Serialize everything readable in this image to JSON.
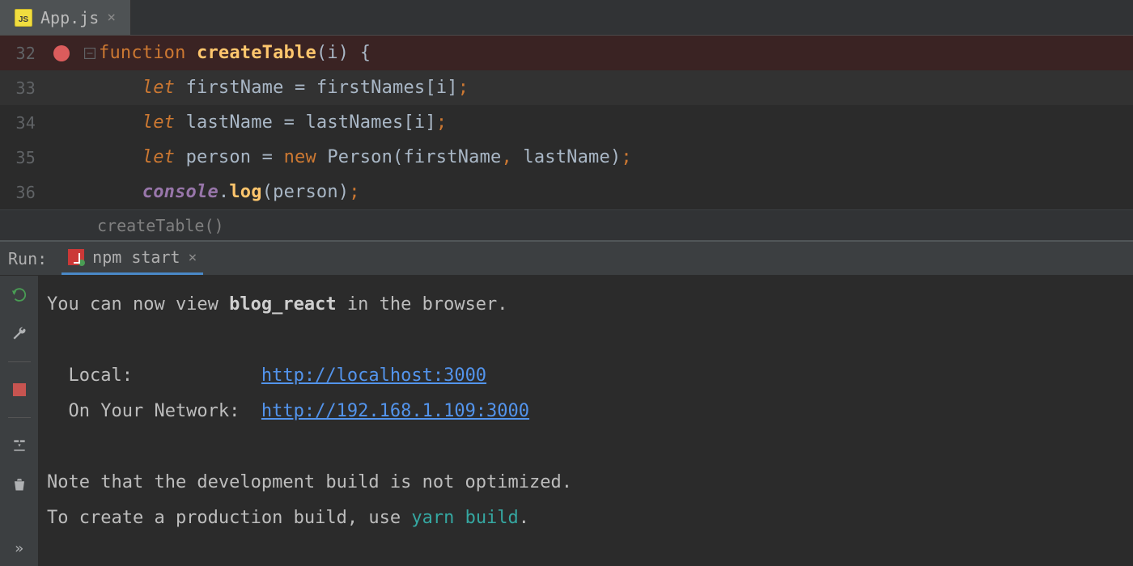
{
  "tab": {
    "filename": "App.js"
  },
  "gutter": {
    "lines": [
      "32",
      "33",
      "34",
      "35",
      "36"
    ]
  },
  "code": {
    "l32": {
      "kw": "function ",
      "fn": "createTable",
      "rest": "(i) {"
    },
    "l33": {
      "let": "let ",
      "name": "firstName",
      "eq": " = ",
      "src": "firstNames[i]",
      "semi": ";"
    },
    "l34": {
      "let": "let ",
      "name": "lastName",
      "eq": " = ",
      "src": "lastNames[i]",
      "semi": ";"
    },
    "l35": {
      "let": "let ",
      "name": "person",
      "eq": " = ",
      "new": "new ",
      "cls": "Person",
      "args": "(firstName",
      "comma": ",",
      "args2": " lastName)",
      "semi": ";"
    },
    "l36": {
      "obj": "console",
      "dot": ".",
      "fn": "log",
      "args": "(person)",
      "semi": ";"
    }
  },
  "breadcrumb": "createTable()",
  "run": {
    "panel_label": "Run:",
    "tab": "npm start",
    "lines": {
      "view1": "You can now view ",
      "project": "blog_react",
      "view2": " in the browser.",
      "local_lbl": "  Local:            ",
      "local_url": "http://localhost:3000",
      "net_lbl": "  On Your Network:  ",
      "net_url": "http://192.168.1.109:3000",
      "note1": "Note that the development build is not optimized.",
      "note2a": "To create a production build, use ",
      "yarn": "yarn build",
      "note2b": "."
    }
  }
}
